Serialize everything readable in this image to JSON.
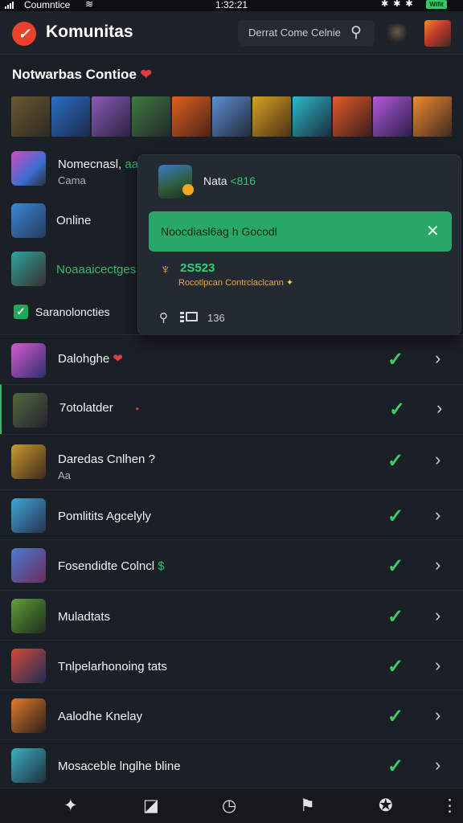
{
  "status_bar": {
    "carrier": "Coumntice",
    "time": "1:32:21",
    "battery_label": "Wifit"
  },
  "header": {
    "app_title": "Komunitas",
    "search_text": "Derrat Come Celnie"
  },
  "section": {
    "title": "Notwarbas Contioe"
  },
  "left_items": [
    {
      "name": "Nomecnasl,",
      "name_accent": "aas",
      "sub": "Cama"
    },
    {
      "name": "Online"
    },
    {
      "name": "Noaaaicectges"
    },
    {
      "name": "Saranoloncties"
    }
  ],
  "popup": {
    "name": "Nata",
    "name_accent": "<816",
    "notice": "Noocdiasl6ag h Gocodl",
    "score": "2S523",
    "description": "Rocotlpcan Contrclaclcann",
    "count": "136"
  },
  "rows": [
    {
      "name": "Dalohghe",
      "heart": "❤",
      "colors": [
        "#d95ad1",
        "#2c2f6b"
      ]
    },
    {
      "name": "7otolatder",
      "mark": "▪",
      "colors": [
        "#4f6b3c",
        "#2a2030"
      ]
    },
    {
      "name": "Daredas Cnlhen ?",
      "sub": "Aa",
      "colors": [
        "#c99a2e",
        "#3d2b1f"
      ]
    },
    {
      "name": "Pomlitits Agcelyly",
      "colors": [
        "#3aa8d8",
        "#2b2f4f"
      ]
    },
    {
      "name": "Fosendidte Colncl",
      "accent": "$",
      "colors": [
        "#4a7bd1",
        "#6b2c5c"
      ]
    },
    {
      "name": "Muladtats",
      "colors": [
        "#5fa13a",
        "#1f2a1b"
      ]
    },
    {
      "name": "Tnlpelarhonoing tats",
      "colors": [
        "#d34b3b",
        "#1f2a55"
      ]
    },
    {
      "name": "Aalodhe Knelay",
      "colors": [
        "#e27a2a",
        "#2a1f1c"
      ]
    },
    {
      "name": "Mosaceble lnglhe bline",
      "colors": [
        "#3bb0c4",
        "#1d2f3d"
      ]
    }
  ],
  "icons": {
    "logo": "logo-icon",
    "search": "search-icon",
    "close": "close-icon",
    "trophy": "trophy-icon",
    "check": "check-icon",
    "chevron": "chevron-right-icon"
  },
  "colors": {
    "accent_green": "#27a866",
    "brand_red": "#e8412c",
    "background": "#1b1f26"
  }
}
